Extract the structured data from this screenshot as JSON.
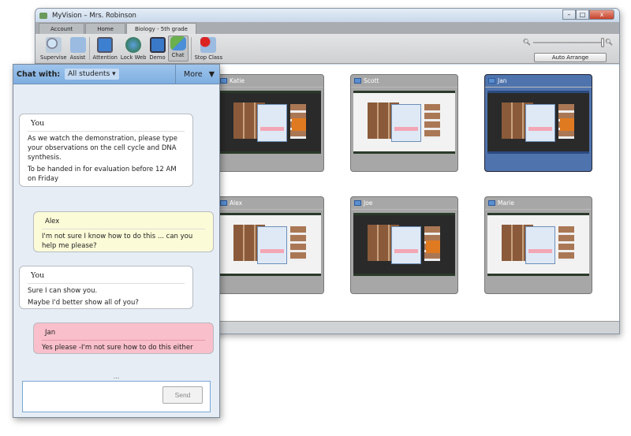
{
  "window": {
    "title": "MyVision – Mrs. Robinson",
    "controls": [
      "–",
      "□",
      "x"
    ]
  },
  "tabs": [
    {
      "label": "Account"
    },
    {
      "label": "Home"
    },
    {
      "label": "Biology - 5th grade"
    }
  ],
  "toolbar": {
    "buttons": [
      {
        "label": "Supervise"
      },
      {
        "label": "Assist"
      },
      {
        "label": "Attention"
      },
      {
        "label": "Lock Web"
      },
      {
        "label": "Demo"
      },
      {
        "label": "Chat"
      },
      {
        "label": "Stop Class"
      }
    ],
    "auto_arrange": "Auto Arrange",
    "zoom_level": 1.0
  },
  "students": [
    {
      "name": "Katie"
    },
    {
      "name": "Scott"
    },
    {
      "name": "Jan"
    },
    {
      "name": "Alex"
    },
    {
      "name": "Joe"
    },
    {
      "name": "Marie"
    }
  ],
  "chat": {
    "chat_with_label": "Chat with:",
    "recipient": "All students",
    "more": "More",
    "messages": [
      {
        "sender": "You",
        "lines": [
          "As we watch the demonstration, please type your observations on the cell cycle and DNA synthesis.",
          "To be handed in for evaluation before 12 AM on Friday"
        ]
      },
      {
        "sender": "Alex",
        "lines": [
          "I'm not sure I know how to do this ... can you help me please?"
        ]
      },
      {
        "sender": "You",
        "lines": [
          "Sure I can show you.",
          "Maybe I'd better show all of you?"
        ]
      },
      {
        "sender": "Jan",
        "lines": [
          "Yes please -I'm not sure how to do this either"
        ]
      }
    ],
    "ellipsis": "...",
    "input_value": "",
    "send": "Send"
  }
}
